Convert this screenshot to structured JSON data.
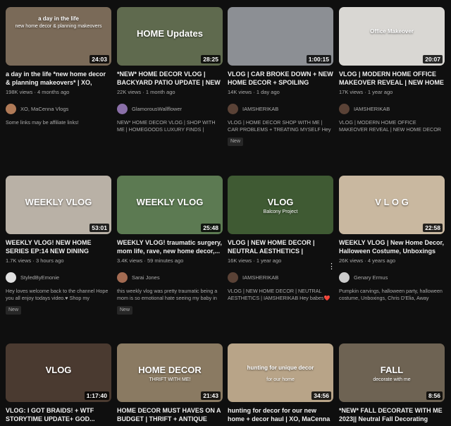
{
  "videos": [
    {
      "title": "a day in the life *new home decor & planning makeovers* | XO, MaCenna Vlogs",
      "views": "198K views",
      "age": "4 months ago",
      "channel": "XO, MaCenna Vlogs",
      "description": "Some links may be affiliate links!",
      "duration": "24:03",
      "overlay": "a day in the life",
      "overlay2": "new home decor & planning makeovers",
      "badge": ""
    },
    {
      "title": "*NEW* HOME DECOR VLOG | BACKYARD PATIO UPDATE | NEW HOMEGOODS LUXURY FINDS",
      "views": "22K views",
      "age": "1 month ago",
      "channel": "GlamorousWallflower",
      "description": "NEW* HOME DECOR VLOG | SHOP WITH ME | HOMEGOODS LUXURY FINDS | BACKYARD",
      "duration": "28:25",
      "overlay": "HOME Updates",
      "overlay2": "",
      "badge": ""
    },
    {
      "title": "VLOG | CAR BROKE DOWN + NEW HOME DECOR + SPOILING MYSELF",
      "views": "14K views",
      "age": "1 day ago",
      "channel": "IAMSHERIKAB",
      "description": "VLOG | HOME DECOR SHOP WITH ME | CAR PROBLEMS + TREATING MYSELF Hey babes❤️ I",
      "duration": "1:00:15",
      "overlay": "",
      "overlay2": "",
      "badge": "New"
    },
    {
      "title": "VLOG | MODERN HOME OFFICE MAKEOVER REVEAL | NEW HOME DECOR",
      "views": "17K views",
      "age": "1 year ago",
      "channel": "IAMSHERIKAB",
      "description": "VLOG | MODERN HOME OFFICE MAKEOVER REVEAL | NEW HOME DECOR Hey babes❤️ I",
      "duration": "20:07",
      "overlay": "Office Makeover",
      "overlay2": "",
      "badge": ""
    },
    {
      "title": "WEEKLY VLOG! NEW HOME SERIES EP:14 NEW DINING FURNITURE...",
      "views": "1.7K views",
      "age": "3 hours ago",
      "channel": "StyledByEmonie",
      "description": "Hey loves welcome back to the channel Hope you all enjoy todays video.♥ Shop my",
      "duration": "53:01",
      "overlay": "WEEKLY VLOG",
      "overlay2": "",
      "badge": "New"
    },
    {
      "title": "WEEKLY VLOG! traumatic surgery, mom life, rave, new home decor,...",
      "views": "3.4K views",
      "age": "59 minutes ago",
      "channel": "Sarai Jones",
      "description": "this weekly vlog was pretty traumatic being a mom is so emotional hate seeing my baby in",
      "duration": "25:48",
      "overlay": "WEEKLY VLOG",
      "overlay2": "",
      "badge": "New"
    },
    {
      "title": "VLOG | NEW HOME DECOR | NEUTRAL AESTHETICS | IAMSHERIKAB",
      "views": "16K views",
      "age": "1 year ago",
      "channel": "IAMSHERIKAB",
      "description": "VLOG | NEW HOME DECOR | NEUTRAL AESTHETICS | IAMSHERIKAB Hey babes❤️ I'm",
      "duration": "",
      "overlay": "VLOG",
      "overlay2": "Balcony Project",
      "badge": ""
    },
    {
      "title": "WEEKLY VLOG | New Home Decor, Halloween Costume, Unboxings",
      "views": "26K views",
      "age": "4 years ago",
      "channel": "Genary Ermus",
      "description": "Pumpkin carvings, halloween party, halloween costume, Unboxings, Chris D'Elia, Away",
      "duration": "22:58",
      "overlay": "V L O G",
      "overlay2": "",
      "badge": ""
    },
    {
      "title": "VLOG: I GOT BRAIDS! + WTF STORYTIME UPDATE+ GOD...",
      "views": "",
      "age": "",
      "channel": "",
      "description": "",
      "duration": "1:17:40",
      "overlay": "VLOG",
      "overlay2": "",
      "badge": ""
    },
    {
      "title": "HOME DECOR MUST HAVES ON A BUDGET | THRIFT + ANTIQUE SHOP...",
      "views": "",
      "age": "",
      "channel": "",
      "description": "",
      "duration": "21:43",
      "overlay": "HOME DECOR",
      "overlay2": "THRIFT WITH ME!",
      "badge": ""
    },
    {
      "title": "hunting for decor for our new home + decor haul | XO, MaCenna Vlogs",
      "views": "",
      "age": "",
      "channel": "",
      "description": "",
      "duration": "34:56",
      "overlay": "hunting for unique decor",
      "overlay2": "for our home",
      "badge": ""
    },
    {
      "title": "*NEW* FALL DECORATE WITH ME 2023|| Neutral Fall Decorating Ideas",
      "views": "",
      "age": "",
      "channel": "",
      "description": "",
      "duration": "8:56",
      "overlay": "FALL",
      "overlay2": "decorate with me",
      "badge": ""
    }
  ],
  "colors": {
    "background": "#0f0f0f",
    "thumbs": [
      "#7a6a58",
      "#5f6a4e",
      "#8c8f94",
      "#d9d7d3",
      "#b9b1a6",
      "#5c7a52",
      "#3f5a33",
      "#c9b8a0",
      "#4a3a30",
      "#8a7a62",
      "#b8a488",
      "#6e6353"
    ],
    "avatars": [
      "#b07a57",
      "#8a6fa8",
      "#5a4236",
      "#5a4236",
      "#e0e0e0",
      "#a36b52",
      "#5a4236",
      "#cccccc"
    ]
  }
}
